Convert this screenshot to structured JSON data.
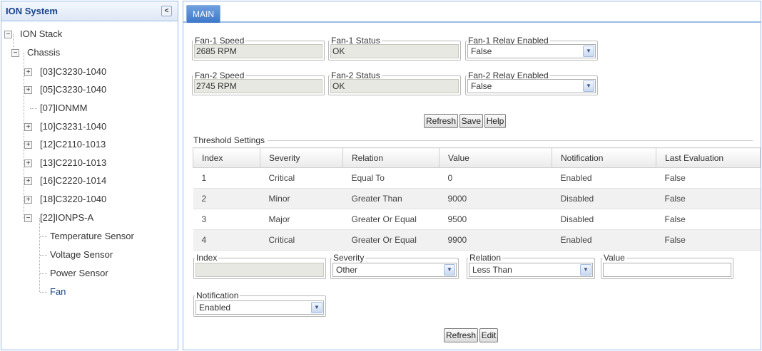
{
  "tree": {
    "title": "ION System",
    "collapse_glyph": "<",
    "nodes": [
      {
        "label": "ION Stack",
        "toggle": "−"
      },
      {
        "label": "Chassis",
        "toggle": "−"
      },
      {
        "label": "[03]C3230-1040",
        "toggle": "+"
      },
      {
        "label": "[05]C3230-1040",
        "toggle": "+"
      },
      {
        "label": "[07]IONMM",
        "toggle": ""
      },
      {
        "label": "[10]C3231-1040",
        "toggle": "+"
      },
      {
        "label": "[12]C2110-1013",
        "toggle": "+"
      },
      {
        "label": "[13]C2210-1013",
        "toggle": "+"
      },
      {
        "label": "[16]C2220-1014",
        "toggle": "+"
      },
      {
        "label": "[18]C3220-1040",
        "toggle": "+"
      },
      {
        "label": "[22]IONPS-A",
        "toggle": "−"
      },
      {
        "label": "Temperature Sensor",
        "toggle": ""
      },
      {
        "label": "Voltage Sensor",
        "toggle": ""
      },
      {
        "label": "Power Sensor",
        "toggle": ""
      },
      {
        "label": "Fan",
        "toggle": ""
      }
    ]
  },
  "tab": {
    "label": "MAIN"
  },
  "fans": {
    "fan1_speed_label": "Fan-1 Speed",
    "fan1_speed_value": "2685 RPM",
    "fan1_status_label": "Fan-1 Status",
    "fan1_status_value": "OK",
    "fan1_relay_label": "Fan-1 Relay Enabled",
    "fan1_relay_value": "False",
    "fan2_speed_label": "Fan-2 Speed",
    "fan2_speed_value": "2745 RPM",
    "fan2_status_label": "Fan-2 Status",
    "fan2_status_value": "OK",
    "fan2_relay_label": "Fan-2 Relay Enabled",
    "fan2_relay_value": "False"
  },
  "buttons": {
    "refresh": "Refresh",
    "save": "Save",
    "help": "Help",
    "edit": "Edit"
  },
  "threshold": {
    "title": "Threshold Settings",
    "columns": [
      "Index",
      "Severity",
      "Relation",
      "Value",
      "Notification",
      "Last Evaluation"
    ],
    "rows": [
      [
        "1",
        "Critical",
        "Equal To",
        "0",
        "Enabled",
        "False"
      ],
      [
        "2",
        "Minor",
        "Greater Than",
        "9000",
        "Disabled",
        "False"
      ],
      [
        "3",
        "Major",
        "Greater Or Equal",
        "9500",
        "Disabled",
        "False"
      ],
      [
        "4",
        "Critical",
        "Greater Or Equal",
        "9900",
        "Enabled",
        "False"
      ]
    ]
  },
  "form": {
    "index_label": "Index",
    "index_value": "",
    "severity_label": "Severity",
    "severity_value": "Other",
    "relation_label": "Relation",
    "relation_value": "Less Than",
    "value_label": "Value",
    "value_value": "",
    "notification_label": "Notification",
    "notification_value": "Enabled"
  },
  "icons": {
    "dropdown": "chevron-down-icon",
    "tree_plus": "plus-icon",
    "tree_minus": "minus-icon"
  }
}
